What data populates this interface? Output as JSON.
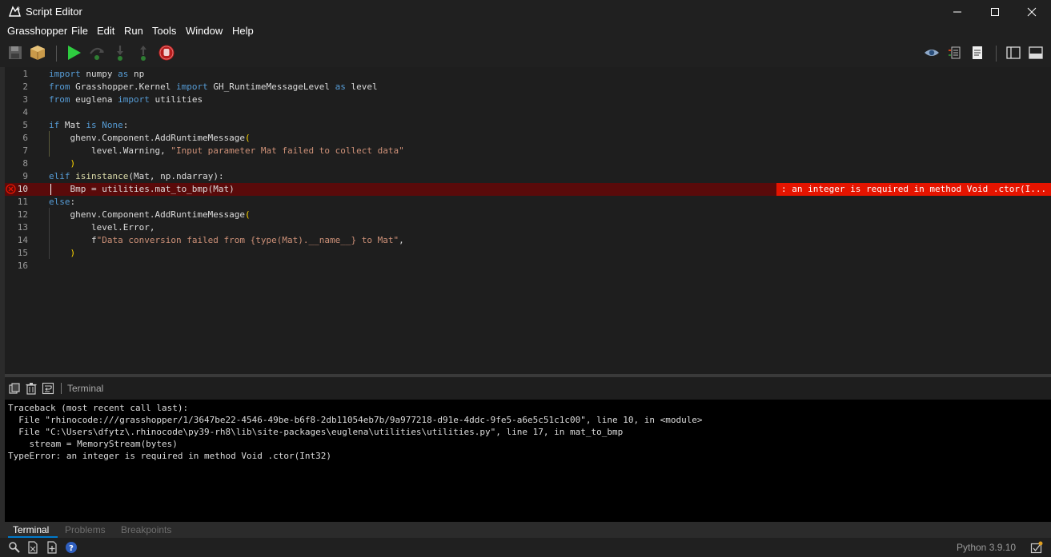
{
  "window": {
    "title": "Script Editor"
  },
  "menu": [
    "Grasshopper",
    "File",
    "Edit",
    "Run",
    "Tools",
    "Window",
    "Help"
  ],
  "editor": {
    "error_line": 10,
    "error_message": ": an integer is required in method Void .ctor(I...",
    "lines": [
      {
        "n": "1"
      },
      {
        "n": "2"
      },
      {
        "n": "3"
      },
      {
        "n": "4"
      },
      {
        "n": "5"
      },
      {
        "n": "6"
      },
      {
        "n": "7"
      },
      {
        "n": "8"
      },
      {
        "n": "9"
      },
      {
        "n": "10"
      },
      {
        "n": "11"
      },
      {
        "n": "12"
      },
      {
        "n": "13"
      },
      {
        "n": "14"
      },
      {
        "n": "15"
      },
      {
        "n": "16"
      }
    ],
    "tokens": {
      "l1_a": "import",
      "l1_b": " numpy ",
      "l1_c": "as",
      "l1_d": " np",
      "l2_a": "from",
      "l2_b": " Grasshopper.Kernel ",
      "l2_c": "import",
      "l2_d": " GH_RuntimeMessageLevel ",
      "l2_e": "as",
      "l2_f": " level",
      "l3_a": "from",
      "l3_b": " euglena ",
      "l3_c": "import",
      "l3_d": " utilities",
      "l5_a": "if",
      "l5_b": " Mat ",
      "l5_c": "is",
      "l5_d": " ",
      "l5_e": "None",
      "l5_f": ":",
      "l6_a": "    ghenv.Component.AddRuntimeMessage",
      "l6_b": "(",
      "l7_a": "        level.Warning, ",
      "l7_b": "\"Input parameter Mat failed to collect data\"",
      "l8_a": "    ",
      "l8_b": ")",
      "l9_a": "elif",
      "l9_b": " ",
      "l9_c": "isinstance",
      "l9_d": "(Mat, np.ndarray):",
      "l10_a": "    Bmp = utilities.mat_to_bmp(Mat)",
      "l11_a": "else",
      "l11_b": ":",
      "l12_a": "    ghenv.Component.AddRuntimeMessage",
      "l12_b": "(",
      "l13_a": "        level.Error,",
      "l14_a": "        f",
      "l14_b": "\"Data conversion failed from {type(Mat).__name__} to Mat\"",
      "l14_c": ",",
      "l15_a": "    ",
      "l15_b": ")"
    }
  },
  "panel": {
    "label": "Terminal"
  },
  "terminal": [
    "Traceback (most recent call last):",
    "  File \"rhinocode:///grasshopper/1/3647be22-4546-49be-b6f8-2db11054eb7b/9a977218-d91e-4ddc-9fe5-a6e5c51c1c00\", line 10, in <module>",
    "  File \"C:\\Users\\dfytz\\.rhinocode\\py39-rh8\\lib\\site-packages\\euglena\\utilities\\utilities.py\", line 17, in mat_to_bmp",
    "    stream = MemoryStream(bytes)",
    "TypeError: an integer is required in method Void .ctor(Int32)"
  ],
  "tabs": [
    "Terminal",
    "Problems",
    "Breakpoints"
  ],
  "status": {
    "python_version": "Python 3.9.10"
  },
  "colors": {
    "error": "#e51400",
    "keyword": "#569cd6",
    "string": "#ce9178",
    "function": "#dcdcaa",
    "bracket": "#ffd700"
  }
}
